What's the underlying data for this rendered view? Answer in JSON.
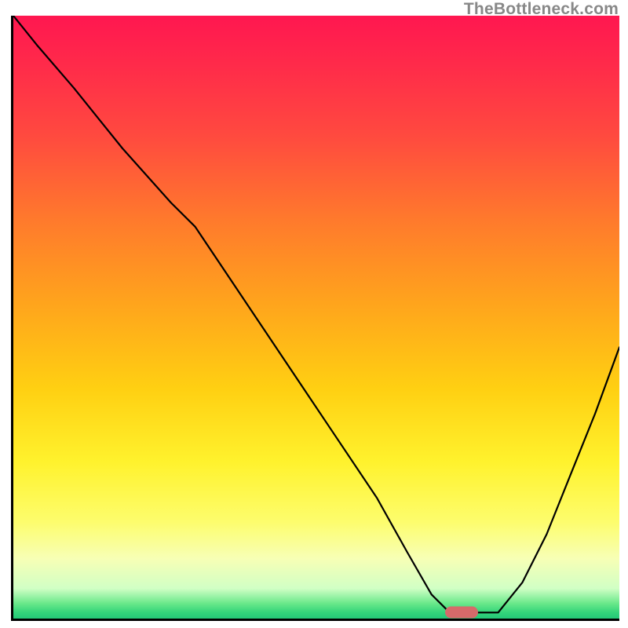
{
  "watermark": "TheBottleneck.com",
  "chart_data": {
    "type": "line",
    "title": "",
    "xlabel": "",
    "ylabel": "",
    "xlim": [
      0,
      100
    ],
    "ylim": [
      0,
      100
    ],
    "grid": false,
    "legend": false,
    "background_gradient": {
      "direction": "vertical",
      "stops": [
        {
          "pos": 0.0,
          "color": "#ff1750"
        },
        {
          "pos": 0.08,
          "color": "#ff2a4a"
        },
        {
          "pos": 0.2,
          "color": "#ff4a3f"
        },
        {
          "pos": 0.34,
          "color": "#ff7a2c"
        },
        {
          "pos": 0.48,
          "color": "#ffa51c"
        },
        {
          "pos": 0.62,
          "color": "#ffd012"
        },
        {
          "pos": 0.74,
          "color": "#fff22d"
        },
        {
          "pos": 0.84,
          "color": "#fdfd6d"
        },
        {
          "pos": 0.9,
          "color": "#f7ffb5"
        },
        {
          "pos": 0.95,
          "color": "#d1ffc5"
        },
        {
          "pos": 0.975,
          "color": "#69e88a"
        },
        {
          "pos": 0.99,
          "color": "#33d47a"
        },
        {
          "pos": 1.0,
          "color": "#24c878"
        }
      ]
    },
    "series": [
      {
        "name": "bottleneck-curve",
        "color": "#000000",
        "x": [
          0,
          4,
          10,
          18,
          26,
          30,
          36,
          44,
          52,
          60,
          65,
          69,
          72,
          76,
          80,
          84,
          88,
          92,
          96,
          100
        ],
        "y": [
          100,
          95,
          88,
          78,
          69,
          65,
          56,
          44,
          32,
          20,
          11,
          4,
          1,
          1,
          1,
          6,
          14,
          24,
          34,
          45
        ]
      }
    ],
    "marker": {
      "name": "optimal-point",
      "x": 74,
      "y": 1,
      "color": "#d66a6a",
      "shape": "pill"
    }
  }
}
